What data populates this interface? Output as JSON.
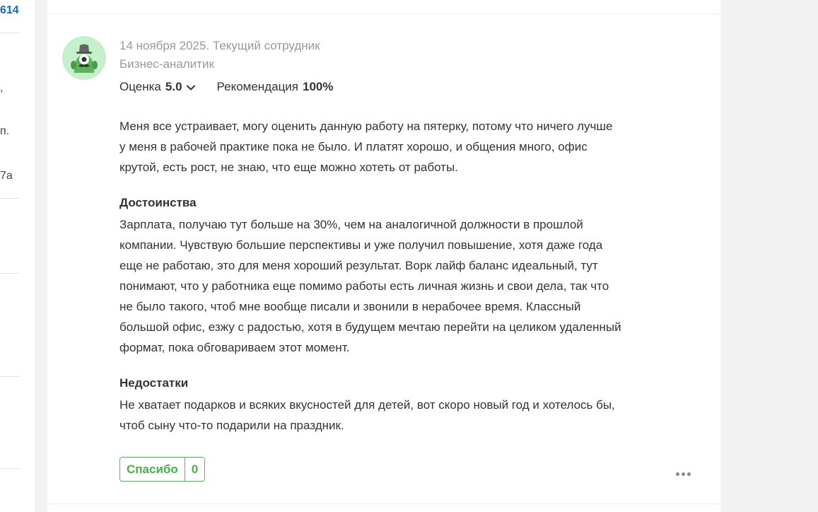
{
  "left_fragments": {
    "link_number": "614",
    "frag_comma": ",",
    "frag_abbrev": "п.",
    "frag_address": "7a"
  },
  "review": {
    "date_line": "14 ноября 2025. Текущий сотрудник",
    "position": "Бизнес-аналитик",
    "rating_label": "Оценка",
    "rating_value": "5.0",
    "recommend_label": "Рекомендация",
    "recommend_value": "100%",
    "text": "Меня все устраивает, могу оценить данную работу на пятерку, потому что ничего лучше у меня в рабочей практике пока не было. И платят хорошо, и общения много, офис крутой, есть рост, не знаю, что еще можно хотеть от работы.",
    "pros_title": "Достоинства",
    "pros_text": "Зарплата, получаю тут больше на 30%, чем на аналогичной должности в прошлой компании. Чувствую большие перспективы и уже получил повышение, хотя даже года еще не работаю, это для меня хороший результат. Ворк лайф баланс идеальный, тут понимают, что у работника еще помимо работы есть личная жизнь и свои дела, так что не было такого, чтоб мне вообще писали и звонили в нерабочее время. Классный большой офис, езжу с радостью, хотя в будущем мечтаю перейти на целиком удаленный формат, пока обговариваем этот момент.",
    "cons_title": "Недостатки",
    "cons_text": "Не хватает подарков и всяких вкусностей для детей, вот скоро новый год и хотелось бы, чтоб сыну что-то подарили на праздник.",
    "thanks_label": "Спасибо",
    "thanks_count": "0"
  },
  "icons": {
    "avatar": "green-monster-avatar-icon",
    "rating_toggle": "chevron-down-icon",
    "more": "more-dots-icon"
  },
  "colors": {
    "accent_green": "#4cae4c",
    "link_blue": "#1769c7",
    "meta_gray": "#999999",
    "page_bg": "#f2f2f2"
  }
}
